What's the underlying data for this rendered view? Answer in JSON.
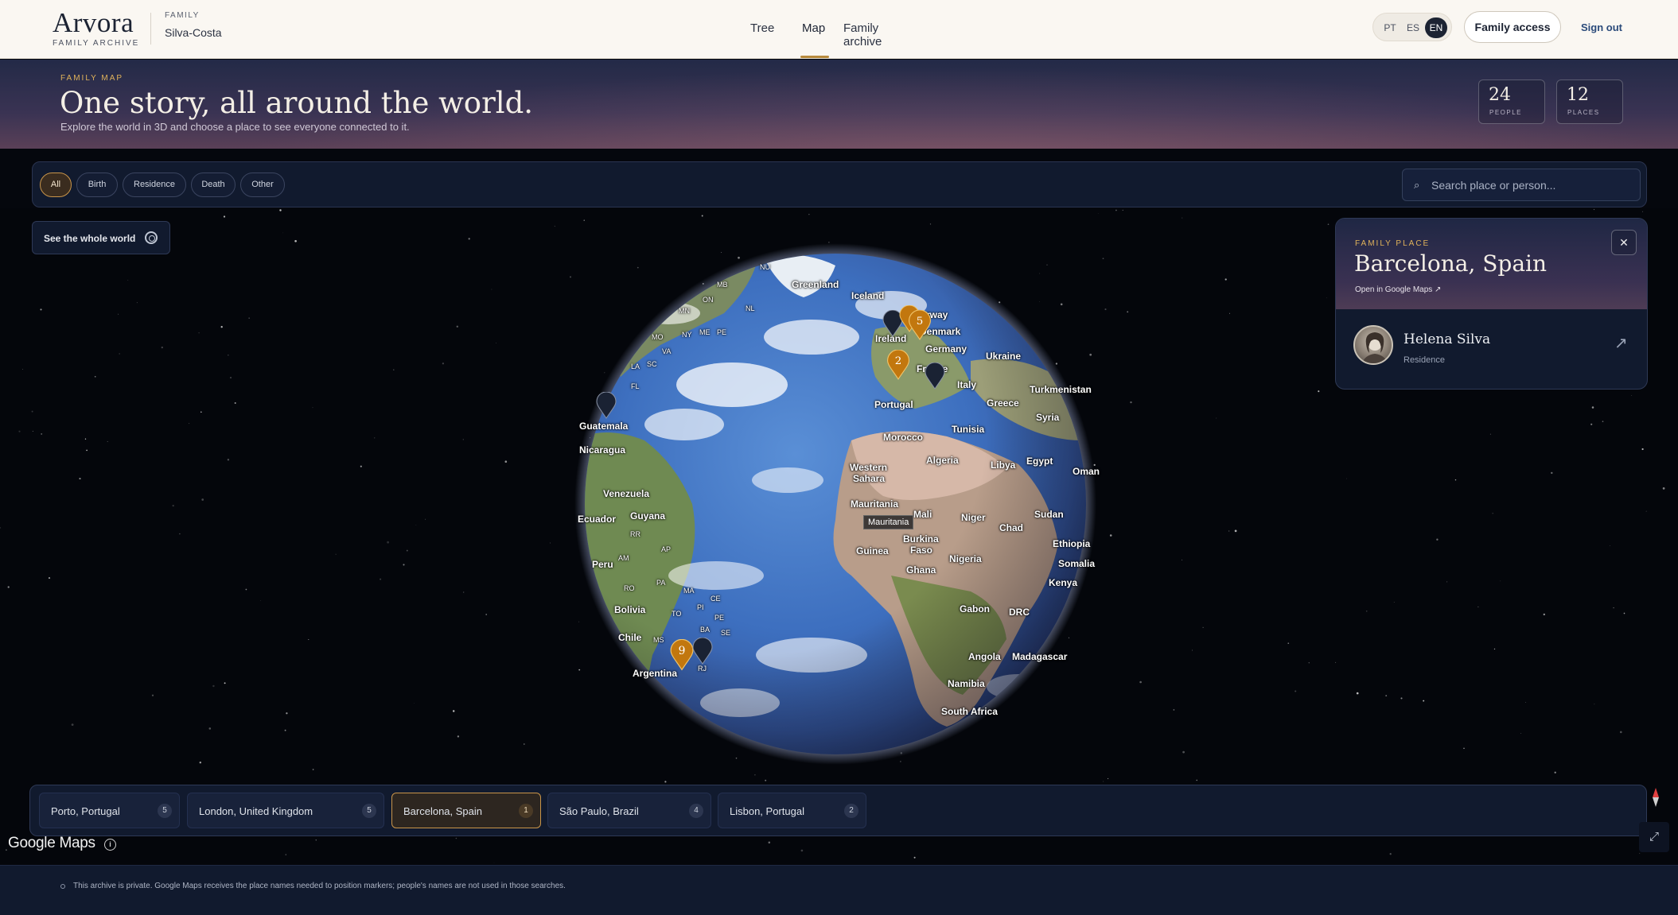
{
  "brand": {
    "name": "Arvora",
    "subtitle": "FAMILY ARCHIVE"
  },
  "family": {
    "label": "FAMILY",
    "value": "Silva-Costa"
  },
  "nav": {
    "tree": "Tree",
    "map": "Map",
    "archive": "Family archive",
    "active": "Map"
  },
  "languages": {
    "pt": "PT",
    "es": "ES",
    "en": "EN",
    "active": "EN"
  },
  "header_actions": {
    "access": "Family access",
    "signout": "Sign out"
  },
  "hero": {
    "eyebrow": "FAMILY MAP",
    "title": "One story, all around the world.",
    "subtitle": "Explore the world in 3D and choose a place to see everyone connected to it."
  },
  "stats": {
    "people": {
      "value": "24",
      "label": "PEOPLE"
    },
    "places": {
      "value": "12",
      "label": "PLACES"
    }
  },
  "filters": {
    "all": "All",
    "birth": "Birth",
    "residence": "Residence",
    "death": "Death",
    "other": "Other",
    "active": "All"
  },
  "search": {
    "placeholder": "Search place or person...",
    "icon": "search-icon"
  },
  "world_button": {
    "label": "See the whole world",
    "icon": "target-icon"
  },
  "map_labels": {
    "nu": "NU",
    "greenland": "Greenland",
    "iceland": "Iceland",
    "mb": "MB",
    "on": "ON",
    "nl": "NL",
    "mn": "MN",
    "ny": "NY",
    "me": "ME",
    "pe_ca": "PE",
    "mo": "MO",
    "va": "VA",
    "sc": "SC",
    "la": "LA",
    "fl": "FL",
    "norway": "Norway",
    "denmark": "Denmark",
    "ireland": "Ireland",
    "germany": "Germany",
    "ukraine": "Ukraine",
    "france": "France",
    "italy": "Italy",
    "turkmenistan": "Turkmenistan",
    "greece": "Greece",
    "portugal": "Portugal",
    "syria": "Syria",
    "guatemala": "Guatemala",
    "morocco": "Morocco",
    "tunisia": "Tunisia",
    "nicaragua": "Nicaragua",
    "western": "Western",
    "sahara": "Sahara",
    "algeria": "Algeria",
    "libya": "Libya",
    "egypt": "Egypt",
    "oman": "Oman",
    "venezuela": "Venezuela",
    "mauritania": "Mauritania",
    "ecuador": "Ecuador",
    "guyana": "Guyana",
    "mali": "Mali",
    "niger": "Niger",
    "chad": "Chad",
    "sudan": "Sudan",
    "rr": "RR",
    "burkina": "Burkina",
    "faso": "Faso",
    "ethiopia": "Ethiopia",
    "ap": "AP",
    "guinea": "Guinea",
    "nigeria": "Nigeria",
    "somalia": "Somalia",
    "peru": "Peru",
    "am": "AM",
    "ghana": "Ghana",
    "pa": "PA",
    "kenya": "Kenya",
    "ro": "RO",
    "ma": "MA",
    "ce": "CE",
    "bolivia": "Bolivia",
    "to": "TO",
    "pi": "PI",
    "gabon": "Gabon",
    "drc": "DRC",
    "pe_br": "PE",
    "ba": "BA",
    "chile": "Chile",
    "ms": "MS",
    "se": "SE",
    "angola": "Angola",
    "madagascar": "Madagascar",
    "argentina": "Argentina",
    "rj": "RJ",
    "namibia": "Namibia",
    "south_africa": "South Africa"
  },
  "tooltip": "Mauritania",
  "pins": {
    "cluster_5": "5",
    "cluster_2": "2",
    "cluster_9": "9"
  },
  "place_card": {
    "eyebrow": "FAMILY PLACE",
    "title": "Barcelona, Spain",
    "link": "Open in Google Maps ↗",
    "close": "✕",
    "person": {
      "name": "Helena Silva",
      "role": "Residence",
      "arrow": "↗"
    }
  },
  "places": [
    {
      "label": "Porto, Portugal",
      "count": "5"
    },
    {
      "label": "London, United Kingdom",
      "count": "5"
    },
    {
      "label": "Barcelona, Spain",
      "count": "1"
    },
    {
      "label": "São Paulo, Brazil",
      "count": "4"
    },
    {
      "label": "Lisbon, Portugal",
      "count": "2"
    }
  ],
  "active_place": "Barcelona, Spain",
  "map_controls": {
    "fullscreen": "⤢",
    "info": "i",
    "logo": "Google Maps"
  },
  "footer": {
    "text": "This archive is private. Google Maps receives the place names needed to position markers; people's names are not used in those searches."
  },
  "colors": {
    "accent": "#c9954a",
    "navy": "#111a2e",
    "gold": "#e0b25a",
    "pin_dark": "#1a2233",
    "pin_orange": "#c2770e"
  }
}
